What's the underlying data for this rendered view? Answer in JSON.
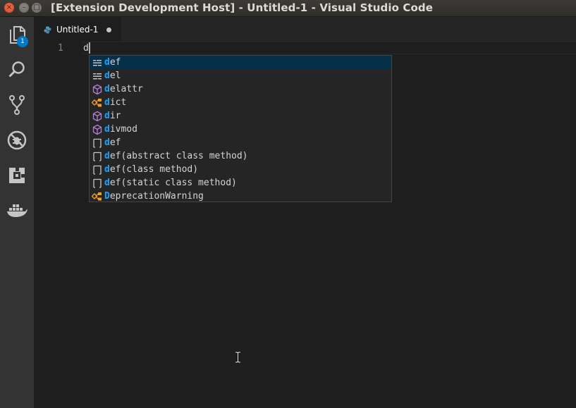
{
  "window": {
    "title": "[Extension Development Host] - Untitled-1 - Visual Studio Code",
    "controls": {
      "close": "×",
      "minimize": "–",
      "maximize": "□"
    }
  },
  "activity_bar": {
    "items": [
      "explorer-icon",
      "search-icon",
      "source-control-icon",
      "debug-icon",
      "extensions-icon",
      "docker-icon"
    ],
    "explorer_badge": "1"
  },
  "tabs": [
    {
      "label": "Untitled-1",
      "icon": "python-icon",
      "dirty": true
    }
  ],
  "editor": {
    "line_number": "1",
    "text": "d"
  },
  "suggest": {
    "items": [
      {
        "match": "d",
        "rest": "ef",
        "kind": "keyword-icon",
        "selected": true
      },
      {
        "match": "d",
        "rest": "el",
        "kind": "keyword-icon"
      },
      {
        "match": "d",
        "rest": "elattr",
        "kind": "method-icon"
      },
      {
        "match": "d",
        "rest": "ict",
        "kind": "class-icon"
      },
      {
        "match": "d",
        "rest": "ir",
        "kind": "method-icon"
      },
      {
        "match": "d",
        "rest": "ivmod",
        "kind": "method-icon"
      },
      {
        "match": "d",
        "rest": "ef",
        "kind": "snippet-icon"
      },
      {
        "match": "d",
        "rest": "ef(abstract class method)",
        "kind": "snippet-icon"
      },
      {
        "match": "d",
        "rest": "ef(class method)",
        "kind": "snippet-icon"
      },
      {
        "match": "d",
        "rest": "ef(static class method)",
        "kind": "snippet-icon"
      },
      {
        "match": "D",
        "rest": "eprecationWarning",
        "kind": "class-icon"
      }
    ]
  },
  "colors": {
    "accent": "#007acc",
    "highlight": "#18a3ff",
    "selection": "#062f4a"
  }
}
